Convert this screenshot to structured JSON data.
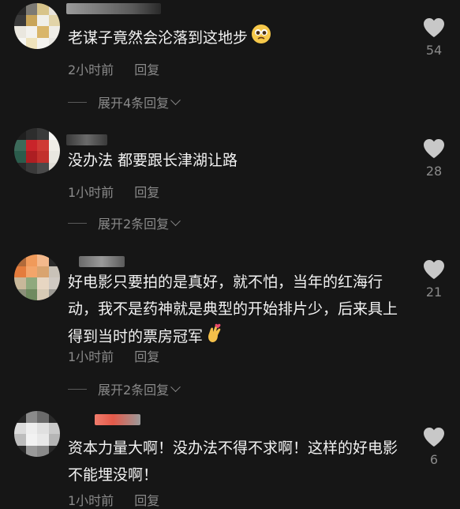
{
  "comments": [
    {
      "text": "老谋子竟然会沦落到这地步",
      "time": "2小时前",
      "reply_label": "回复",
      "expand_label": "展开4条回复",
      "likes": "54",
      "emoji": "pleading-face-emoji"
    },
    {
      "text": "没办法 都要跟长津湖让路",
      "time": "1小时前",
      "reply_label": "回复",
      "expand_label": "展开2条回复",
      "likes": "28"
    },
    {
      "text": "好电影只要拍的是真好，就不怕，当年的红海行动，我不是药神就是典型的开始排片少，后来具上得到当时的票房冠军",
      "time": "1小时前",
      "reply_label": "回复",
      "expand_label": "展开2条回复",
      "likes": "21",
      "emoji": "finger-heart-emoji"
    },
    {
      "text": "资本力量大啊！没办法不得不求啊！这样的好电影不能埋没啊！",
      "time": "1小时前",
      "reply_label": "回复",
      "likes": "6"
    }
  ],
  "colors": {
    "background": "#161616",
    "text": "#f2f2f2",
    "muted": "#8a8a8a",
    "heart": "#c8c8c8"
  }
}
